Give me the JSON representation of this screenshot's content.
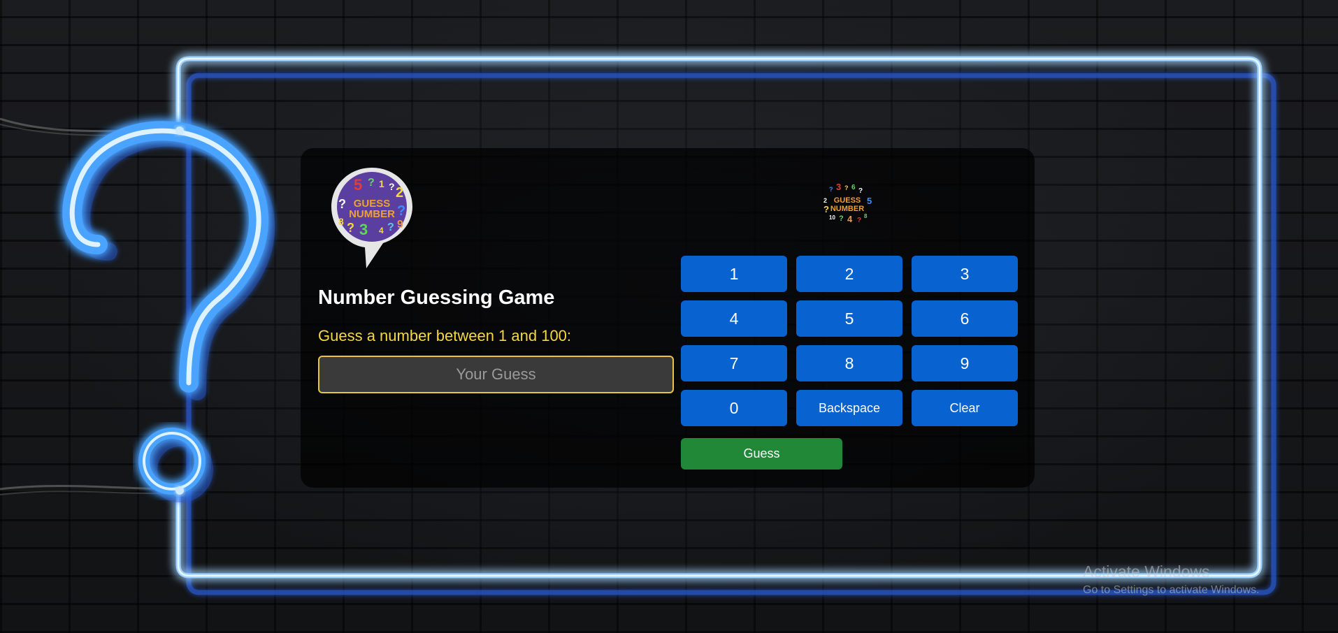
{
  "game": {
    "title": "Number Guessing Game",
    "prompt": "Guess a number between 1 and 100:",
    "input_placeholder": "Your Guess",
    "input_value": ""
  },
  "logo": {
    "text_line1": "GUESS",
    "text_line2": "NUMBER",
    "digits": [
      "5",
      "?",
      "1",
      "?",
      "2",
      "?",
      "?",
      "8",
      "?",
      "3",
      "4",
      "?",
      "9"
    ]
  },
  "small_logo": {
    "text_line1": "GUESS",
    "text_line2": "NUMBER",
    "digits": [
      "?",
      "3",
      "?",
      "6",
      "?",
      "2",
      "5",
      "?",
      "10",
      "?",
      "4",
      "?",
      "8"
    ]
  },
  "keypad": {
    "keys": [
      "1",
      "2",
      "3",
      "4",
      "5",
      "6",
      "7",
      "8",
      "9",
      "0",
      "Backspace",
      "Clear"
    ]
  },
  "guess_button_label": "Guess",
  "windows_activation": {
    "line1": "Activate Windows",
    "line2": "Go to Settings to activate Windows."
  },
  "colors": {
    "neon_blue": "#3d8bff",
    "key_blue": "#0862cf",
    "guess_green": "#218838",
    "prompt_yellow": "#f5d742",
    "logo_purple": "#5b3fa0"
  }
}
